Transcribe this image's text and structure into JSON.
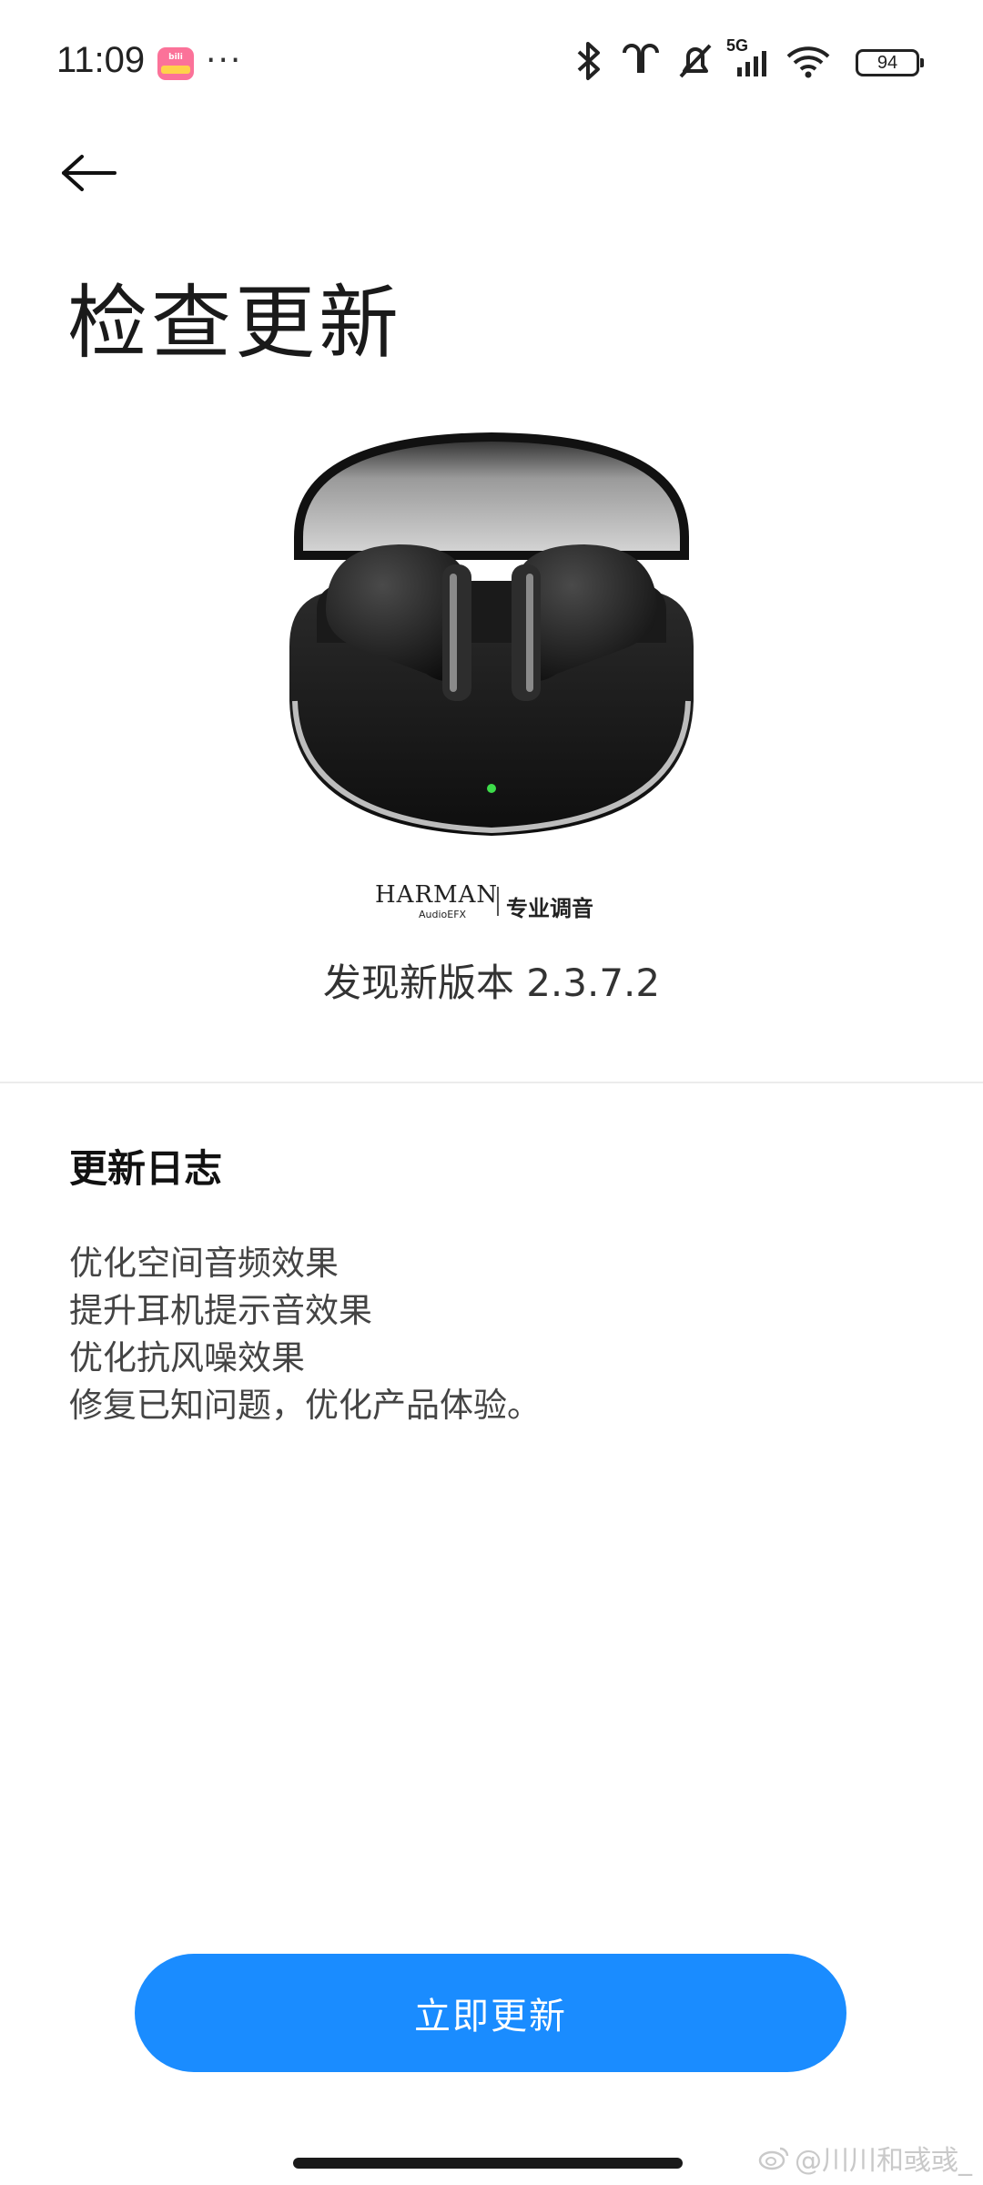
{
  "status_bar": {
    "time": "11:09",
    "app_icon": "bilibili-icon",
    "more": "···",
    "network": "5G",
    "battery": "94"
  },
  "title": "检查更新",
  "product": {
    "brand": "HARMAN",
    "brand_sub": "AudioEFX",
    "brand_tag": "专业调音"
  },
  "version": "发现新版本 2.3.7.2",
  "changelog": {
    "heading": "更新日志",
    "items": [
      "优化空间音频效果",
      "提升耳机提示音效果",
      "优化抗风噪效果",
      "修复已知问题，优化产品体验。"
    ]
  },
  "update_button": "立即更新",
  "watermark": "@川川和彧彧_",
  "colors": {
    "accent": "#1a8cff",
    "bilibili": "#fb7299"
  }
}
